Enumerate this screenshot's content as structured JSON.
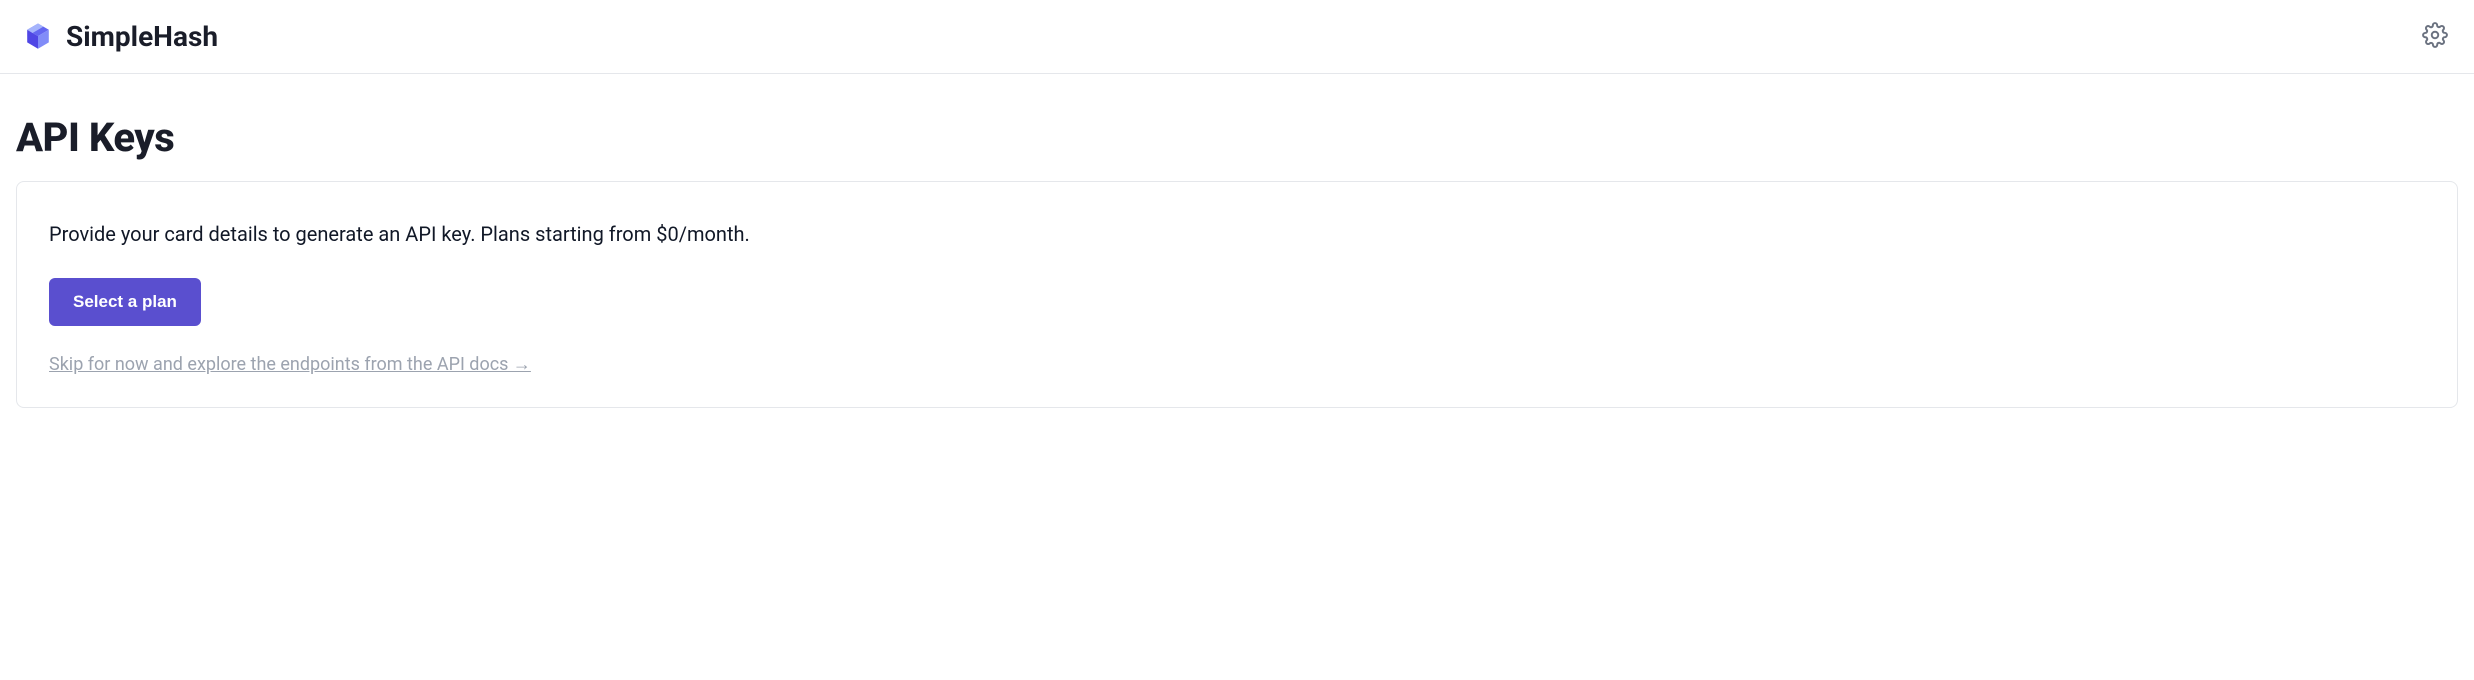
{
  "header": {
    "brand": "SimpleHash"
  },
  "page": {
    "title": "API Keys"
  },
  "card": {
    "description": "Provide your card details to generate an API key. Plans starting from $0/month.",
    "cta_label": "Select a plan",
    "skip_label": "Skip for now and explore the endpoints from the API docs →"
  }
}
